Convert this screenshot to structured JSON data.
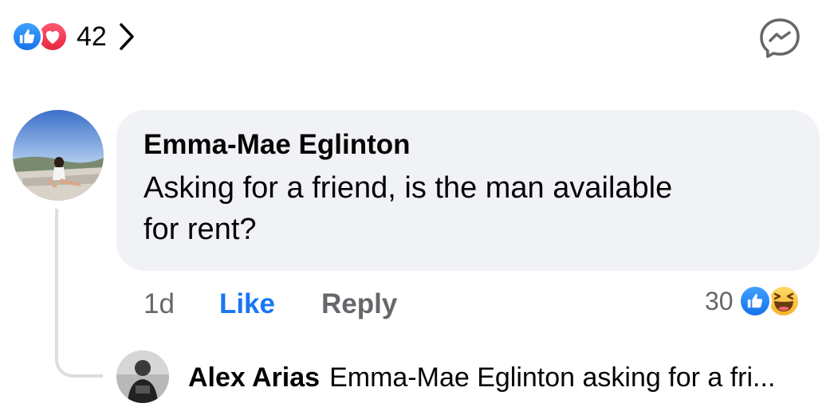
{
  "post_reactions": {
    "count": "42",
    "icons": [
      "like-icon",
      "love-icon"
    ]
  },
  "header": {
    "chevron_icon": "chevron-right-icon",
    "messenger_icon": "messenger-icon"
  },
  "comment": {
    "author": "Emma-Mae Eglinton",
    "text_line1": "Asking for a friend, is the man available",
    "text_line2": "for rent?",
    "time": "1d",
    "like_label": "Like",
    "reply_label": "Reply",
    "reaction_count": "30",
    "reaction_icons": [
      "like-icon",
      "haha-icon"
    ]
  },
  "reply": {
    "author": "Alex Arias",
    "preview": "Emma-Mae Eglinton asking for a fri..."
  },
  "colors": {
    "like_blue": "#1877f2",
    "love_red": "#f02849",
    "bubble_bg": "#f0f2f5",
    "secondary_text": "#65676b"
  }
}
